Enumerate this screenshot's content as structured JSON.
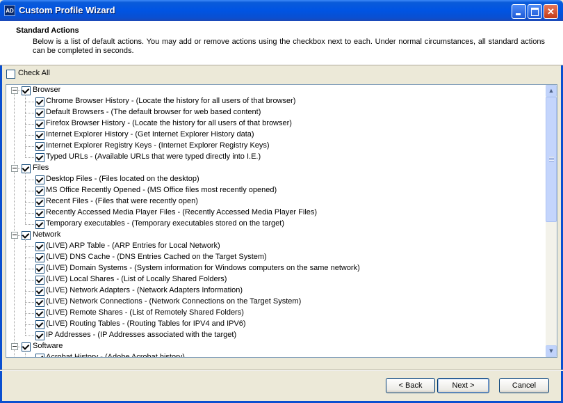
{
  "window": {
    "title": "Custom Profile Wizard",
    "icon_text": "AD",
    "controls": [
      "minimize-icon",
      "maximize-icon",
      "close-icon"
    ]
  },
  "header": {
    "title": "Standard Actions",
    "description": "Below is a list of default actions.  You may add or remove actions using the checkbox next to each.  Under normal circumstances, all standard actions can be completed in seconds."
  },
  "check_all": {
    "label": "Check All",
    "checked": false
  },
  "tree": {
    "groups": [
      {
        "label": "Browser",
        "checked": true,
        "expanded": true,
        "items": [
          "Chrome Browser History - (Locate the history for all users of that browser)",
          "Default Browsers - (The default browser for web based content)",
          "Firefox Browser History - (Locate the history for all users of that browser)",
          "Internet Explorer History - (Get Internet Explorer History data)",
          "Internet Explorer Registry Keys - (Internet Explorer Registry Keys)",
          "Typed URLs - (Available URLs that were typed directly into I.E.)"
        ]
      },
      {
        "label": "Files",
        "checked": true,
        "expanded": true,
        "items": [
          "Desktop Files - (Files located on the desktop)",
          "MS Office Recently Opened - (MS Office files most recently opened)",
          "Recent Files - (Files that were recently open)",
          "Recently Accessed Media Player Files - (Recently Accessed Media Player Files)",
          "Temporary executables - (Temporary executables stored on the target)"
        ]
      },
      {
        "label": "Network",
        "checked": true,
        "expanded": true,
        "items": [
          "(LIVE) ARP Table - (ARP Entries for Local Network)",
          "(LIVE) DNS Cache - (DNS Entries Cached on the Target System)",
          "(LIVE) Domain Systems - (System information for Windows computers on the same network)",
          "(LIVE) Local Shares - (List of Locally Shared Folders)",
          "(LIVE) Network Adapters - (Network Adapters Information)",
          "(LIVE) Network Connections - (Network Connections on the Target System)",
          "(LIVE) Remote Shares - (List of Remotely Shared Folders)",
          "(LIVE) Routing Tables - (Routing Tables for IPV4 and IPV6)",
          "IP Addresses - (IP Addresses associated with the target)"
        ]
      },
      {
        "label": "Software",
        "checked": true,
        "expanded": true,
        "items": [
          "Acrobat History - (Adobe Acrobat history)"
        ]
      }
    ]
  },
  "footer": {
    "back_label": "< Back",
    "next_label": "Next >",
    "cancel_label": "Cancel"
  },
  "colors": {
    "titlebar": "#0054e3",
    "dialog_bg": "#ece9d8",
    "tree_border": "#7f9db9",
    "button_border": "#003c74"
  }
}
